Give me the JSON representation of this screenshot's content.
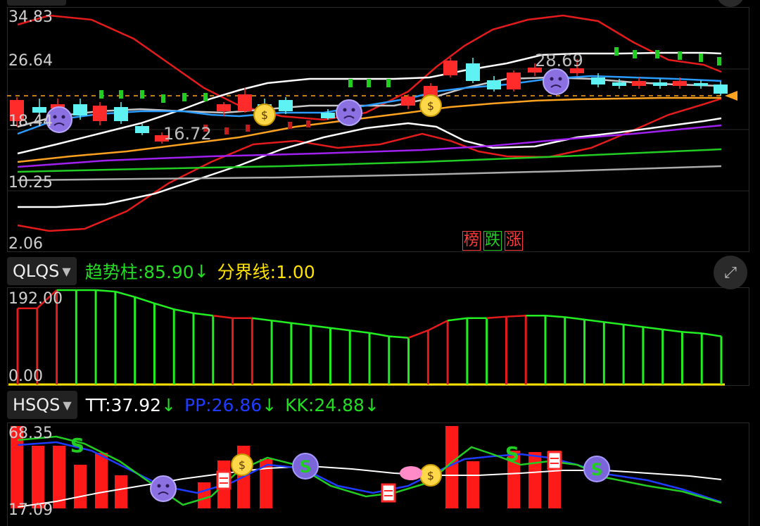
{
  "main": {
    "axis": [
      "34.83",
      "26.64",
      "18.44",
      "10.25",
      "2.06"
    ],
    "high_label": "28.69",
    "low_label": "16.72",
    "tags": [
      {
        "text": "榜",
        "color": "#ff3b3b"
      },
      {
        "text": "跌",
        "color": "#22cc22"
      },
      {
        "text": "涨",
        "color": "#ff3b3b"
      }
    ]
  },
  "qlqs": {
    "name": "QLQS",
    "trend_label": "趋势柱:85.90",
    "trend_arrow": "↓",
    "divider_label": "分界线:1.00",
    "axis_top": "192.00",
    "axis_bottom": "0.00",
    "values": [
      155,
      155,
      192,
      192,
      192,
      189,
      178,
      165,
      153,
      145,
      140,
      135,
      135,
      130,
      125,
      120,
      115,
      110,
      105,
      98,
      95,
      110,
      130,
      135,
      135,
      138,
      140,
      140,
      137,
      132,
      127,
      122,
      117,
      112,
      107,
      104,
      98
    ],
    "colors": [
      "r",
      "r",
      "r",
      "g",
      "g",
      "g",
      "g",
      "g",
      "g",
      "g",
      "g",
      "r",
      "r",
      "g",
      "g",
      "g",
      "g",
      "g",
      "g",
      "g",
      "g",
      "r",
      "r",
      "g",
      "g",
      "r",
      "r",
      "g",
      "g",
      "g",
      "g",
      "g",
      "g",
      "g",
      "g",
      "g",
      "g"
    ]
  },
  "hsqs": {
    "name": "HSQS",
    "tt_label": "TT:37.92",
    "tt_arrow": "↓",
    "pp_label": "PP:26.86",
    "pp_arrow": "↓",
    "kk_label": "KK:24.88",
    "kk_arrow": "↓",
    "axis_top": "68.35",
    "axis_bottom": "17.09",
    "colors": {
      "tt": "#ffffff",
      "pp": "#1f3bff",
      "kk": "#22cc22",
      "bar": "#ff1a1a"
    }
  },
  "colors": {
    "up": "#ff2a2a",
    "down": "#5ff2f2",
    "green": "#22dd22",
    "yellow": "#ffe100",
    "orange": "#ffa21f"
  },
  "icons": [
    "money-bag-icon",
    "sad-face-icon",
    "s-signal-icon",
    "calendar-icon",
    "expand-icon",
    "caret-down-icon",
    "price-pointer-icon"
  ]
}
